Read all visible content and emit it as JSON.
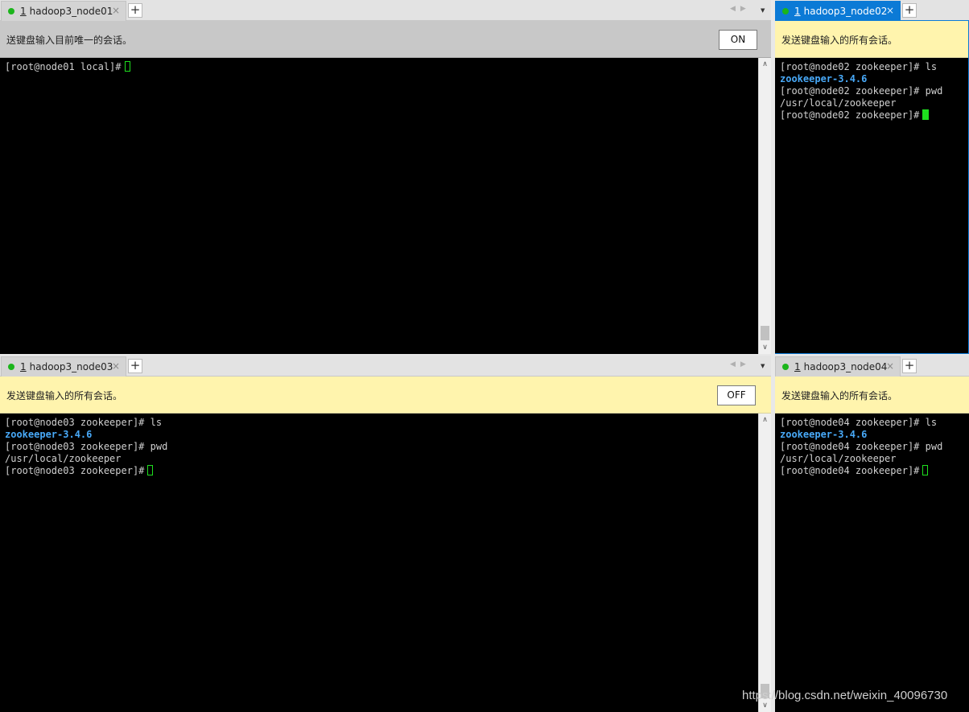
{
  "panes": {
    "node01": {
      "tab": {
        "num": "1",
        "title": "hadoop3_node01"
      },
      "banner": {
        "text": "送键盘输入目前唯一的会话。",
        "button": "ON"
      },
      "lines": [
        {
          "text": "[root@node01 local]#",
          "blue": false
        }
      ]
    },
    "node02": {
      "tab": {
        "num": "1",
        "title": "hadoop3_node02"
      },
      "banner": {
        "text": "发送键盘输入的所有会话。"
      },
      "lines": [
        {
          "text": "[root@node02 zookeeper]# ls",
          "blue": false
        },
        {
          "text": "zookeeper-3.4.6",
          "blue": true
        },
        {
          "text": "[root@node02 zookeeper]# pwd",
          "blue": false
        },
        {
          "text": "/usr/local/zookeeper",
          "blue": false
        },
        {
          "text": "[root@node02 zookeeper]#",
          "blue": false
        }
      ]
    },
    "node03": {
      "tab": {
        "num": "1",
        "title": "hadoop3_node03"
      },
      "banner": {
        "text": "发送键盘输入的所有会话。",
        "button": "OFF"
      },
      "lines": [
        {
          "text": "[root@node03 zookeeper]# ls",
          "blue": false
        },
        {
          "text": "zookeeper-3.4.6",
          "blue": true
        },
        {
          "text": "[root@node03 zookeeper]# pwd",
          "blue": false
        },
        {
          "text": "/usr/local/zookeeper",
          "blue": false
        },
        {
          "text": "[root@node03 zookeeper]#",
          "blue": false
        }
      ]
    },
    "node04": {
      "tab": {
        "num": "1",
        "title": "hadoop3_node04"
      },
      "banner": {
        "text": "发送键盘输入的所有会话。"
      },
      "lines": [
        {
          "text": "[root@node04 zookeeper]# ls",
          "blue": false
        },
        {
          "text": "zookeeper-3.4.6",
          "blue": true
        },
        {
          "text": "[root@node04 zookeeper]# pwd",
          "blue": false
        },
        {
          "text": "/usr/local/zookeeper",
          "blue": false
        },
        {
          "text": "[root@node04 zookeeper]#",
          "blue": false
        }
      ]
    }
  },
  "icons": {
    "close": "×",
    "add": "+",
    "nav": "◀▶",
    "menu": "▼",
    "scroll_up": "∧",
    "scroll_down": "∨"
  },
  "colors": {
    "active_tab": "#0b7ad6",
    "banner_yellow": "#fff4ad",
    "banner_gray": "#c8c8c8",
    "dir_blue": "#48a9f8",
    "cursor_green": "#1ee01e",
    "status_dot": "#1bb51b"
  },
  "watermark": "https://blog.csdn.net/weixin_40096730"
}
